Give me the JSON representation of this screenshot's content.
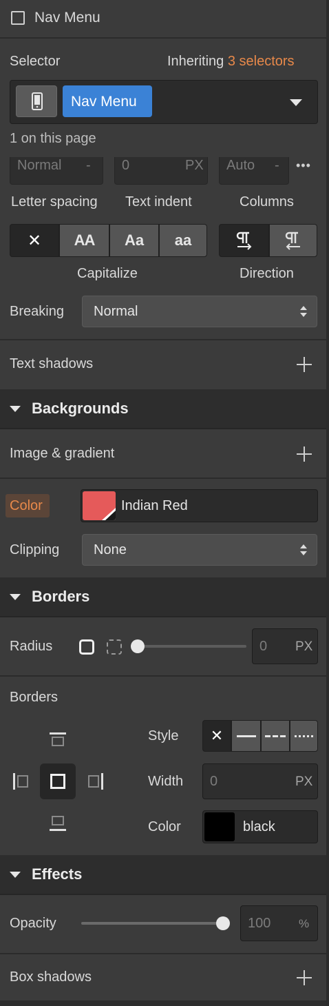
{
  "header": {
    "title": "Nav Menu"
  },
  "selector": {
    "label": "Selector",
    "inheriting_prefix": "Inheriting",
    "inheriting_link": "3 selectors",
    "tag": "Nav Menu",
    "on_page": "1 on this page"
  },
  "typography": {
    "letter_spacing_value": "Normal",
    "letter_spacing_unit": "-",
    "text_indent_value": "0",
    "text_indent_unit": "PX",
    "columns_value": "Auto",
    "columns_unit": "-",
    "more": "•••",
    "letter_spacing_label": "Letter spacing",
    "text_indent_label": "Text indent",
    "columns_label": "Columns",
    "capitalize_options": [
      "✕",
      "AA",
      "Aa",
      "aa"
    ],
    "capitalize_label": "Capitalize",
    "direction_label": "Direction",
    "breaking_label": "Breaking",
    "breaking_value": "Normal",
    "text_shadows_label": "Text shadows"
  },
  "backgrounds": {
    "title": "Backgrounds",
    "image_gradient_label": "Image & gradient",
    "color_label": "Color",
    "color_name": "Indian Red",
    "color_hex": "#e55a5a",
    "clipping_label": "Clipping",
    "clipping_value": "None"
  },
  "borders": {
    "title": "Borders",
    "radius_label": "Radius",
    "radius_value": "0",
    "radius_unit": "PX",
    "borders_label": "Borders",
    "style_label": "Style",
    "width_label": "Width",
    "width_value": "0",
    "width_unit": "PX",
    "color_label": "Color",
    "color_value": "black",
    "color_hex": "#000000"
  },
  "effects": {
    "title": "Effects",
    "opacity_label": "Opacity",
    "opacity_value": "100",
    "opacity_unit": "%",
    "opacity_fraction": 1.0,
    "box_shadows_label": "Box shadows"
  },
  "colors": {
    "accent_orange": "#e8894a",
    "tag_blue": "#3b82d6"
  }
}
